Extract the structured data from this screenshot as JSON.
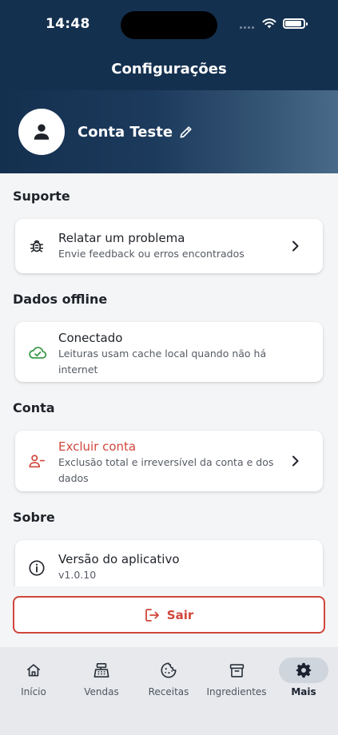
{
  "status": {
    "time": "14:48"
  },
  "header": {
    "title": "Configurações"
  },
  "profile": {
    "name": "Conta Teste"
  },
  "sections": {
    "support": {
      "title": "Suporte",
      "item": {
        "title": "Relatar um problema",
        "subtitle": "Envie feedback ou erros encontrados",
        "icon": "bug-icon"
      }
    },
    "offline": {
      "title": "Dados offline",
      "item": {
        "title": "Conectado",
        "subtitle": "Leituras usam cache local quando não há internet",
        "icon": "cloud-check-icon"
      }
    },
    "account": {
      "title": "Conta",
      "item": {
        "title": "Excluir conta",
        "subtitle": "Exclusão total e irreversível da conta e dos dados",
        "icon": "user-remove-icon"
      }
    },
    "about": {
      "title": "Sobre",
      "item": {
        "title": "Versão do aplicativo",
        "subtitle": "v1.0.10",
        "icon": "info-icon"
      }
    }
  },
  "logout": {
    "label": "Sair",
    "icon": "logout-icon"
  },
  "tabs": [
    {
      "label": "Início",
      "icon": "home-icon"
    },
    {
      "label": "Vendas",
      "icon": "cash-register-icon"
    },
    {
      "label": "Receitas",
      "icon": "cookie-icon"
    },
    {
      "label": "Ingredientes",
      "icon": "archive-icon"
    },
    {
      "label": "Mais",
      "icon": "gear-icon",
      "active": true
    }
  ],
  "colors": {
    "header": "#14304f",
    "danger": "#d0463b",
    "success": "#3b9a4a",
    "background": "#f4f5f7",
    "tabbar": "#e7e9ec"
  }
}
